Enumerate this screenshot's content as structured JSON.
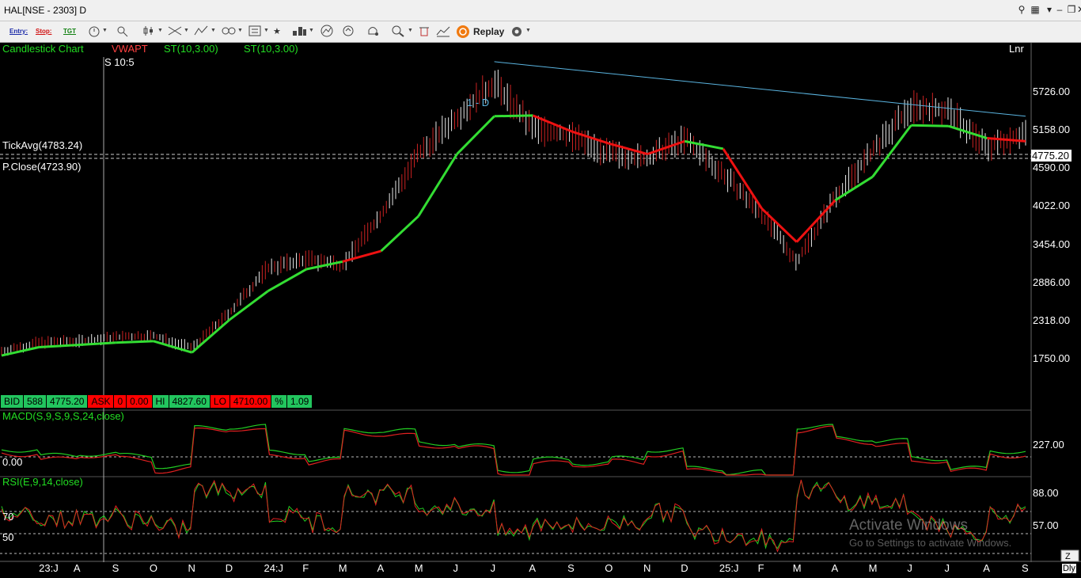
{
  "window": {
    "title": "HAL[NSE - 2303] D"
  },
  "toolbar": {
    "entry": "Entry:",
    "stop": "Stop:",
    "tgt": "TGT",
    "replay": "Replay"
  },
  "price_panel": {
    "chart_type": "Candlestick Chart",
    "indicators": [
      "VWAPT",
      "ST(10,3.00)",
      "ST(10,3.00)"
    ],
    "cursor_label": "S 10:5",
    "scale": "Lnr",
    "tick_avg": "TickAvg(4783.24)",
    "prev_close": "P.Close(4723.90)",
    "trendline_label": "1 - D",
    "last_price": "4775.20",
    "y_ticks": [
      "5726.00",
      "5158.00",
      "4590.00",
      "4022.00",
      "3454.00",
      "2886.00",
      "2318.00",
      "1750.00"
    ]
  },
  "quote": {
    "bid_label": "BID",
    "bid_qty": "588",
    "bid": "4775.20",
    "ask_label": "ASK",
    "ask_qty": "0",
    "ask": "0.00",
    "hi_label": "HI",
    "hi": "4827.60",
    "lo_label": "LO",
    "lo": "4710.00",
    "pct_label": "%",
    "pct": "1.09"
  },
  "macd": {
    "label": "MACD(S,9,S,9,S,24,close)",
    "zero": "0.00",
    "tick": "227.00"
  },
  "rsi": {
    "label": "RSI(E,9,14,close)",
    "l70": "70",
    "l50": "50",
    "ticks": [
      "88.00",
      "57.00"
    ]
  },
  "x_axis": [
    "23:J",
    "A",
    "S",
    "O",
    "N",
    "D",
    "24:J",
    "F",
    "M",
    "A",
    "M",
    "J",
    "J",
    "A",
    "S",
    "O",
    "N",
    "D",
    "25:J",
    "F",
    "M",
    "A",
    "M",
    "J",
    "J",
    "A",
    "S"
  ],
  "period_button": "Dly",
  "watermark": {
    "line1": "Activate Windows",
    "line2": "Go to Settings to activate Windows."
  },
  "chart_data": {
    "type": "line",
    "title": "HAL[NSE - 2303] D",
    "y_scale": "linear",
    "ylim": [
      1350,
      5950
    ],
    "series": [
      {
        "name": "ST(10,3.00)",
        "x": [
          "2023-06-01",
          "2023-07-01",
          "2023-08-01",
          "2023-09-01",
          "2023-10-01",
          "2023-11-01",
          "2023-12-01",
          "2024-01-01",
          "2024-02-01",
          "2024-03-01",
          "2024-04-01",
          "2024-05-01",
          "2024-06-01",
          "2024-07-01",
          "2024-08-01",
          "2024-09-01",
          "2024-10-01",
          "2024-11-01",
          "2024-12-01",
          "2025-01-01",
          "2025-02-01",
          "2025-03-01",
          "2025-04-01",
          "2025-05-01",
          "2025-06-01",
          "2025-07-01",
          "2025-08-01",
          "2025-09-01"
        ],
        "values": [
          1820,
          1930,
          1960,
          1990,
          2010,
          1860,
          2290,
          2670,
          2960,
          3060,
          3200,
          3660,
          4480,
          4980,
          4990,
          4780,
          4620,
          4480,
          4650,
          4550,
          3760,
          3320,
          3870,
          4180,
          4860,
          4850,
          4690,
          4650
        ]
      }
    ],
    "close_series": {
      "name": "Close",
      "values": [
        1880,
        1990,
        2010,
        2060,
        2080,
        1920,
        2380,
        2980,
        3090,
        3020,
        3680,
        4470,
        4980,
        5420,
        4820,
        4720,
        4480,
        4420,
        4680,
        4220,
        3680,
        3060,
        3920,
        4510,
        5110,
        5050,
        4560,
        4775
      ]
    },
    "trendline": {
      "x": [
        "2024-07-01",
        "2025-09-01"
      ],
      "values": [
        5700,
        4980
      ]
    },
    "reference_lines": {
      "tick_avg": 4783.24,
      "prev_close": 4723.9
    }
  }
}
